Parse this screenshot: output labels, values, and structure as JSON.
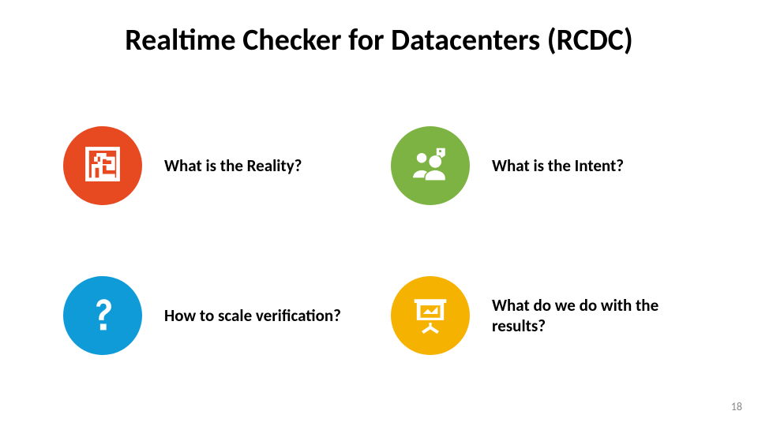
{
  "title": "Realtime Checker for Datacenters (RCDC)",
  "items": [
    {
      "label": "What is the Reality?",
      "color": "c-orange",
      "icon_name": "maze-icon"
    },
    {
      "label": "What is the Intent?",
      "color": "c-green",
      "icon_name": "people-question-icon"
    },
    {
      "label": "How to scale verification?",
      "color": "c-blue",
      "icon_name": "question-mark-icon"
    },
    {
      "label": "What do we do with the results?",
      "color": "c-yellow",
      "icon_name": "presentation-board-icon"
    }
  ],
  "page_number": "18",
  "colors": {
    "orange": "#e74a21",
    "green": "#7cb342",
    "blue": "#0f9bd7",
    "yellow": "#f6b200"
  }
}
